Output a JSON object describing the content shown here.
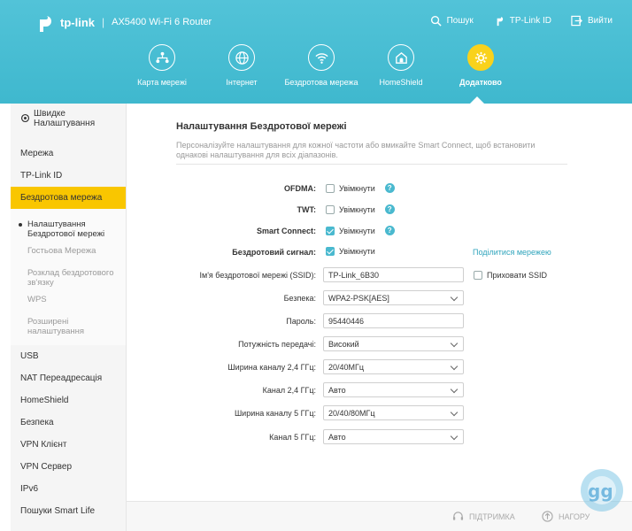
{
  "header": {
    "brand": "tp-link",
    "separator": "|",
    "model": "AX5400 Wi-Fi 6 Router",
    "links": [
      {
        "icon": "search-icon",
        "label": "Пошук"
      },
      {
        "icon": "tplink-id-icon",
        "label": "TP-Link ID"
      },
      {
        "icon": "logout-icon",
        "label": "Вийти"
      }
    ]
  },
  "nav": [
    {
      "icon": "network-map-icon",
      "label": "Карта мережі"
    },
    {
      "icon": "globe-icon",
      "label": "Інтернет"
    },
    {
      "icon": "wifi-icon",
      "label": "Бездротова мережа"
    },
    {
      "icon": "homeshield-icon",
      "label": "HomeShield"
    },
    {
      "icon": "gear-icon",
      "label": "Додатково",
      "active": true
    }
  ],
  "sidebar": {
    "quick": "Швидке Налаштування",
    "items_top": [
      "Мережа",
      "TP-Link ID",
      "Бездротова мережа"
    ],
    "sub": [
      "Налаштування Бездротової мережі",
      "Гостьова Мережа",
      "Розклад бездротового зв'язку",
      "WPS",
      "Розширені налаштування"
    ],
    "items_bottom": [
      "USB",
      "NAT Переадресація",
      "HomeShield",
      "Безпека",
      "VPN Клієнт",
      "VPN Сервер",
      "IPv6",
      "Пошуки Smart Life"
    ]
  },
  "main": {
    "title": "Налаштування Бездротової мережі",
    "description": "Персоналізуйте налаштування для кожної частоти або вмикайте Smart Connect, щоб встановити однакові налаштування для всіх діапазонів.",
    "ofdma": {
      "label": "OFDMA:",
      "text": "Увімкнути"
    },
    "twt": {
      "label": "TWT:",
      "text": "Увімкнути"
    },
    "smart_connect": {
      "label": "Smart Connect:",
      "text": "Увімкнути"
    },
    "broadcast": {
      "label": "Бездротовий сигнал:",
      "text": "Увімкнути",
      "share": "Поділитися мережею"
    },
    "ssid": {
      "label": "Ім'я бездротової мережі (SSID):",
      "value": "TP-Link_6B30",
      "hide": "Приховати SSID"
    },
    "security": {
      "label": "Безпека:",
      "value": "WPA2-PSK[AES]"
    },
    "password": {
      "label": "Пароль:",
      "value": "95440446"
    },
    "tx_power": {
      "label": "Потужність передачі:",
      "value": "Високий"
    },
    "width_24": {
      "label": "Ширина каналу 2,4 ГГц:",
      "value": "20/40МГц"
    },
    "channel_24": {
      "label": "Канал 2,4 ГГц:",
      "value": "Авто"
    },
    "width_5": {
      "label": "Ширина каналу 5 ГГц:",
      "value": "20/40/80МГц"
    },
    "channel_5": {
      "label": "Канал 5 ГГц:",
      "value": "Авто"
    }
  },
  "footer": {
    "support": "ПІДТРИМКА",
    "top": "НАГОРУ"
  },
  "colors": {
    "header": "#45bdd2",
    "accent": "#f9c600",
    "check": "#4ab9cf"
  }
}
